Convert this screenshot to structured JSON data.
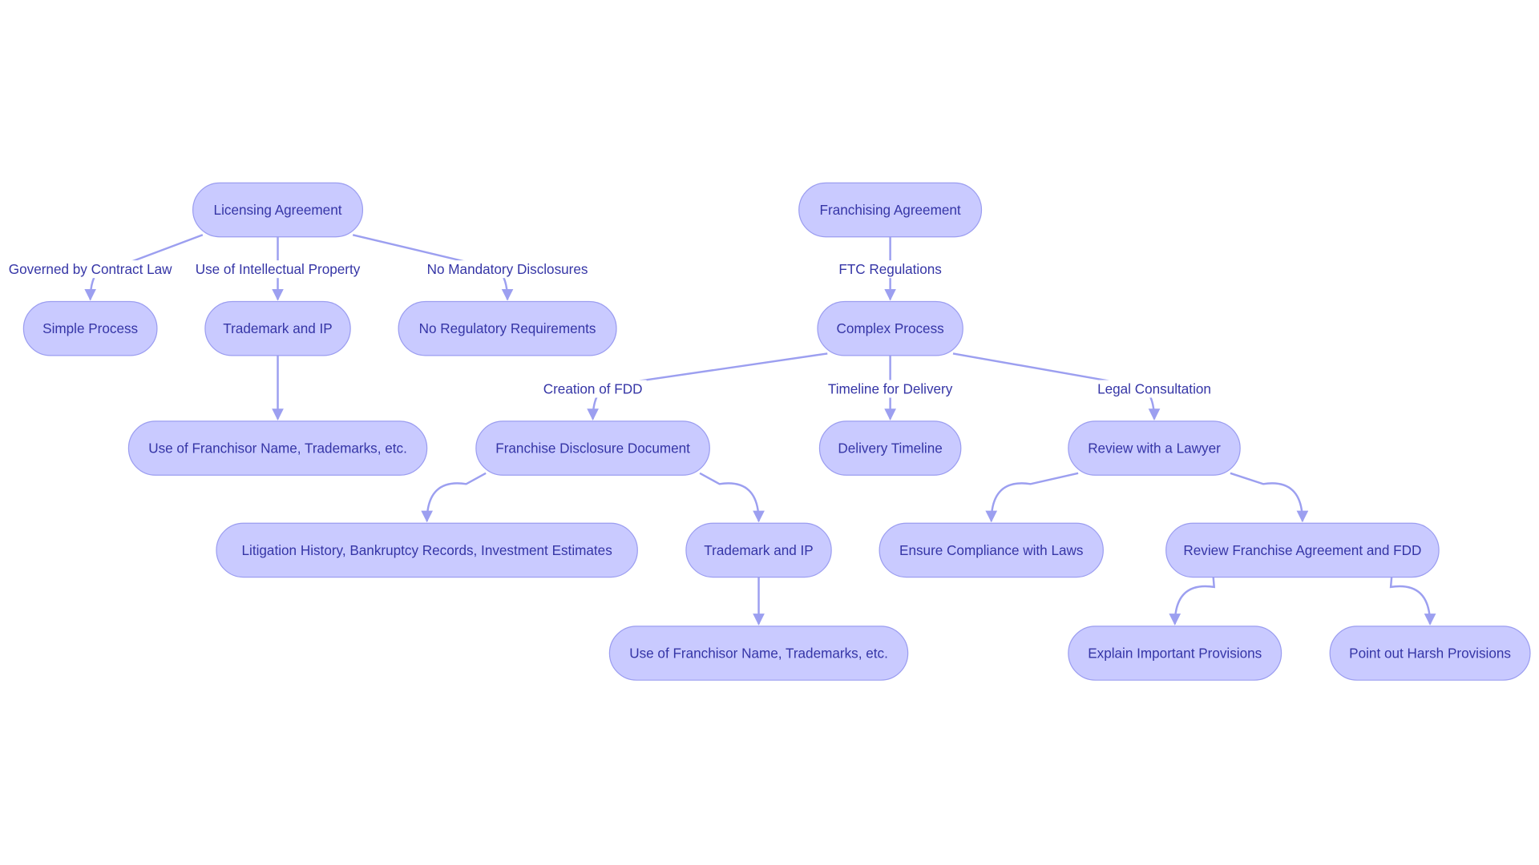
{
  "diagram": {
    "colors": {
      "node_fill": "#c9caff",
      "node_stroke": "#9b9df0",
      "text": "#3535a6",
      "edge": "#9c9ff0"
    },
    "nodes": [
      {
        "id": "lic",
        "label": "Licensing Agreement"
      },
      {
        "id": "fra",
        "label": "Franchising Agreement"
      },
      {
        "id": "simple",
        "label": "Simple Process"
      },
      {
        "id": "tip1",
        "label": "Trademark and IP"
      },
      {
        "id": "noreg",
        "label": "No Regulatory Requirements"
      },
      {
        "id": "complex",
        "label": "Complex Process"
      },
      {
        "id": "usefr1",
        "label": "Use of Franchisor Name, Trademarks, etc."
      },
      {
        "id": "fdd",
        "label": "Franchise Disclosure Document"
      },
      {
        "id": "deliv",
        "label": "Delivery Timeline"
      },
      {
        "id": "lawyer",
        "label": "Review with a Lawyer"
      },
      {
        "id": "litig",
        "label": "Litigation History, Bankruptcy Records, Investment Estimates"
      },
      {
        "id": "tip2",
        "label": "Trademark and IP"
      },
      {
        "id": "ensure",
        "label": "Ensure Compliance with Laws"
      },
      {
        "id": "review",
        "label": "Review Franchise Agreement and FDD"
      },
      {
        "id": "usefr2",
        "label": "Use of Franchisor Name, Trademarks, etc."
      },
      {
        "id": "explain",
        "label": "Explain Important Provisions"
      },
      {
        "id": "point",
        "label": "Point out Harsh Provisions"
      }
    ],
    "edges": [
      {
        "from": "lic",
        "to": "simple",
        "label": "Governed by Contract Law"
      },
      {
        "from": "lic",
        "to": "tip1",
        "label": "Use of Intellectual Property"
      },
      {
        "from": "lic",
        "to": "noreg",
        "label": "No Mandatory Disclosures"
      },
      {
        "from": "fra",
        "to": "complex",
        "label": "FTC Regulations"
      },
      {
        "from": "tip1",
        "to": "usefr1",
        "label": ""
      },
      {
        "from": "complex",
        "to": "fdd",
        "label": "Creation of FDD"
      },
      {
        "from": "complex",
        "to": "deliv",
        "label": "Timeline for Delivery"
      },
      {
        "from": "complex",
        "to": "lawyer",
        "label": "Legal Consultation"
      },
      {
        "from": "fdd",
        "to": "litig",
        "label": ""
      },
      {
        "from": "fdd",
        "to": "tip2",
        "label": ""
      },
      {
        "from": "tip2",
        "to": "usefr2",
        "label": ""
      },
      {
        "from": "lawyer",
        "to": "ensure",
        "label": ""
      },
      {
        "from": "lawyer",
        "to": "review",
        "label": ""
      },
      {
        "from": "review",
        "to": "explain",
        "label": ""
      },
      {
        "from": "review",
        "to": "point",
        "label": ""
      }
    ]
  }
}
